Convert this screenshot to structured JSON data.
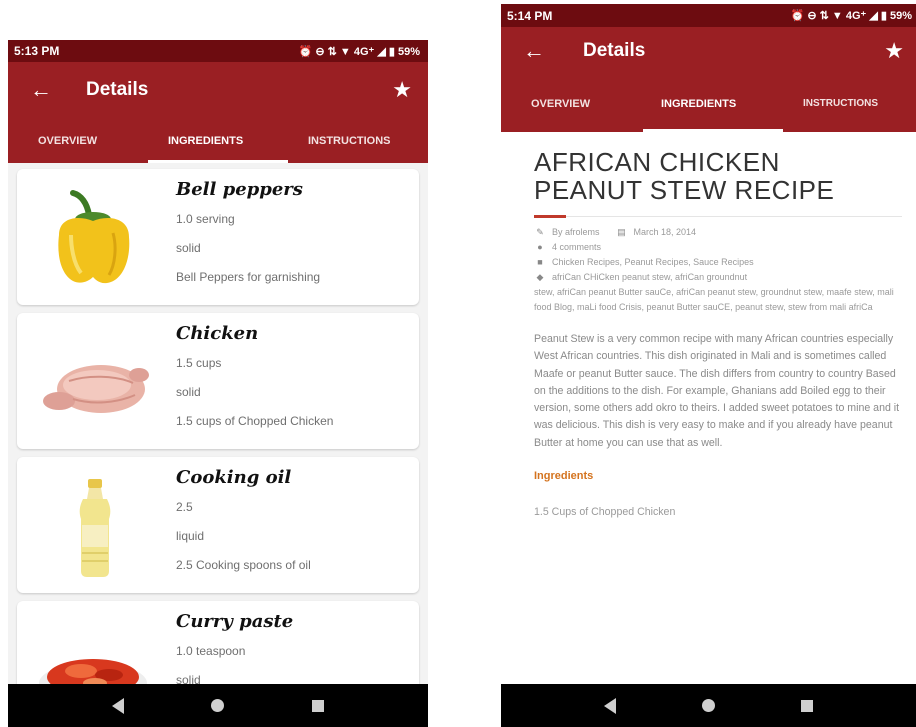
{
  "left": {
    "status": {
      "time": "5:13 PM",
      "icons": "⏰ ⊖ ⇅ ▼ 4G⁺ ◢ ▮ 59%"
    },
    "appbar": {
      "back_icon": "←",
      "title": "Details",
      "star_icon": "★"
    },
    "tabs": [
      {
        "label": "OVERVIEW"
      },
      {
        "label": "INGREDIENTS",
        "active": true
      },
      {
        "label": "INSTRUCTIONS"
      }
    ],
    "ingredients": [
      {
        "name": "Bell peppers",
        "amount": "1.0  serving",
        "state": "solid",
        "note": "Bell Peppers for garnishing",
        "image": "bell-pepper-icon"
      },
      {
        "name": "Chicken",
        "amount": "1.5  cups",
        "state": "solid",
        "note": "1.5 cups of Chopped Chicken",
        "image": "chicken-icon"
      },
      {
        "name": "Cooking oil",
        "amount": "2.5",
        "state": "liquid",
        "note": "2.5 Cooking spoons of oil",
        "image": "oil-bottle-icon"
      },
      {
        "name": "Curry paste",
        "amount": "1.0  teaspoon",
        "state": "solid",
        "note": "",
        "image": "curry-paste-icon"
      }
    ]
  },
  "right": {
    "status": {
      "time": "5:14 PM",
      "icons": "⏰ ⊖ ⇅ ▼ 4G⁺ ◢ ▮ 59%"
    },
    "appbar": {
      "back_icon": "←",
      "title": "Details",
      "star_icon": "★"
    },
    "tabs": [
      {
        "label": "OVERVIEW"
      },
      {
        "label": "INGREDIENTS",
        "active": true
      },
      {
        "label": "INSTRUCTIONS"
      }
    ],
    "article": {
      "title_line1": "AFRICAN CHICKEN",
      "title_line2": "PEANUT STEW RECIPE",
      "author": "By afrolems",
      "date": "March 18, 2014",
      "comments": "4 comments",
      "categories": "Chicken Recipes, Peanut Recipes, Sauce Recipes",
      "tags_first": "afriCan CHiCken peanut stew, afriCan groundnut",
      "tags_rest": "stew, afriCan peanut Butter sauCe, afriCan peanut stew, groundnut stew, maafe stew, mali food Blog, maLi food Crisis, peanut Butter sauCE, peanut stew, stew from mali afriCa",
      "body": "Peanut Stew is a very common recipe with many African countries especially West African countries. This dish originated in Mali and is sometimes called Maafe or peanut Butter sauce. The dish differs from country to country Based on the additions to the dish. For example, Ghanians add Boiled egg to their version, some others add okro to theirs. I added sweet potatoes to mine and it was delicious. This dish is very easy to make and if you already have peanut Butter at home you can use that as well.",
      "ingredients_heading": "Ingredients",
      "first_ingredient": "1.5 Cups of Chopped Chicken"
    }
  },
  "colors": {
    "status_bar": "#6d0c10",
    "app_bar": "#9a1f23",
    "ingredients_heading": "#d4731e"
  }
}
